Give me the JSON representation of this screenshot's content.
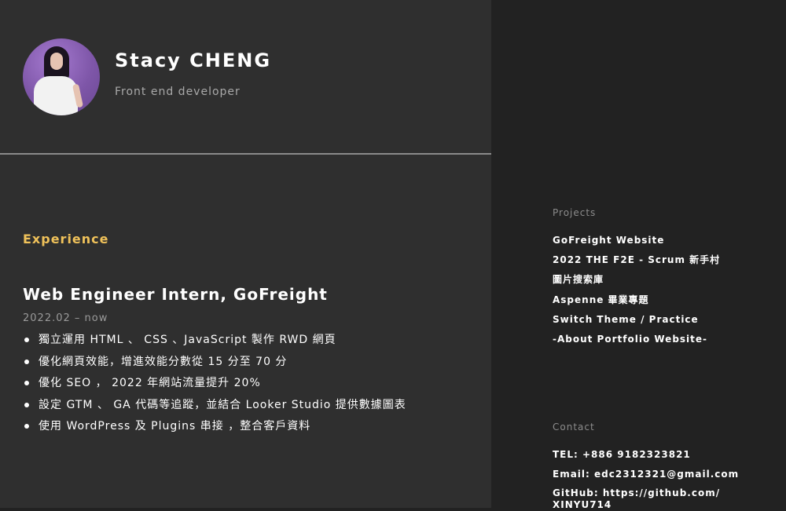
{
  "profile": {
    "name": "Stacy CHENG",
    "role": "Front end developer"
  },
  "experience": {
    "heading": "Experience",
    "jobs": [
      {
        "title": "Web Engineer Intern, GoFreight",
        "date": "2022.02 – now",
        "bullets": [
          "獨立運用 HTML 、 CSS 、JavaScript 製作 RWD 網頁",
          "優化網頁效能，增進效能分數從 15 分至 70 分",
          "優化 SEO ， 2022 年網站流量提升 20%",
          "設定 GTM 、 GA 代碼等追蹤，並結合 Looker Studio 提供數據圖表",
          "使用 WordPress 及 Plugins 串接 ，整合客戶資料"
        ]
      }
    ]
  },
  "projects": {
    "heading": "Projects",
    "items": [
      "GoFreight Website",
      "2022 THE F2E - Scrum 新手村",
      "圖片搜索庫",
      "Aspenne 畢業專題",
      "Switch Theme / Practice",
      "-About Portfolio Website-"
    ]
  },
  "contact": {
    "heading": "Contact",
    "tel": "TEL: +886 9182323821",
    "email": "Email: edc2312321@gmail.com",
    "github": "GitHub: https://github.com/XINYU714"
  }
}
